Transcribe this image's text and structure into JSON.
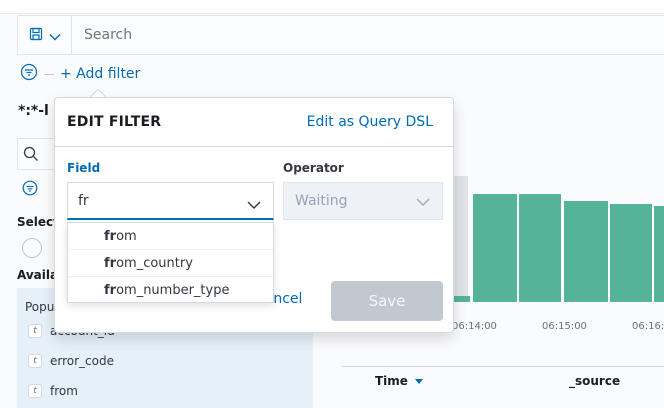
{
  "search": {
    "placeholder": "Search"
  },
  "filter_bar": {
    "add_filter_label": "+ Add filter"
  },
  "sidebar": {
    "index_pattern": "*:*-l",
    "selected_heading": "Selecte",
    "available_heading": "Availa",
    "popular_heading": "Popu",
    "fields": [
      {
        "type": "t",
        "name": "account_id"
      },
      {
        "type": "t",
        "name": "error_code"
      },
      {
        "type": "t",
        "name": "from"
      }
    ]
  },
  "chart": {
    "x_ticks": [
      "06:14:00",
      "06:15:00",
      "06:16:0"
    ]
  },
  "table": {
    "columns": [
      "Time",
      "_source"
    ]
  },
  "edit_filter": {
    "title": "EDIT FILTER",
    "edit_dsl_label": "Edit as Query DSL",
    "field_label": "Field",
    "field_value": "fr",
    "operator_label": "Operator",
    "operator_value": "Waiting",
    "cancel_label": "Cancel",
    "save_label": "Save",
    "suggestions": [
      {
        "match": "fr",
        "rest": "om"
      },
      {
        "match": "fr",
        "rest": "om_country"
      },
      {
        "match": "fr",
        "rest": "om_number_type"
      }
    ]
  },
  "colors": {
    "accent": "#006bb4",
    "bar": "#54b399",
    "field_label": "#006bb4",
    "operator_label": "#343741"
  }
}
